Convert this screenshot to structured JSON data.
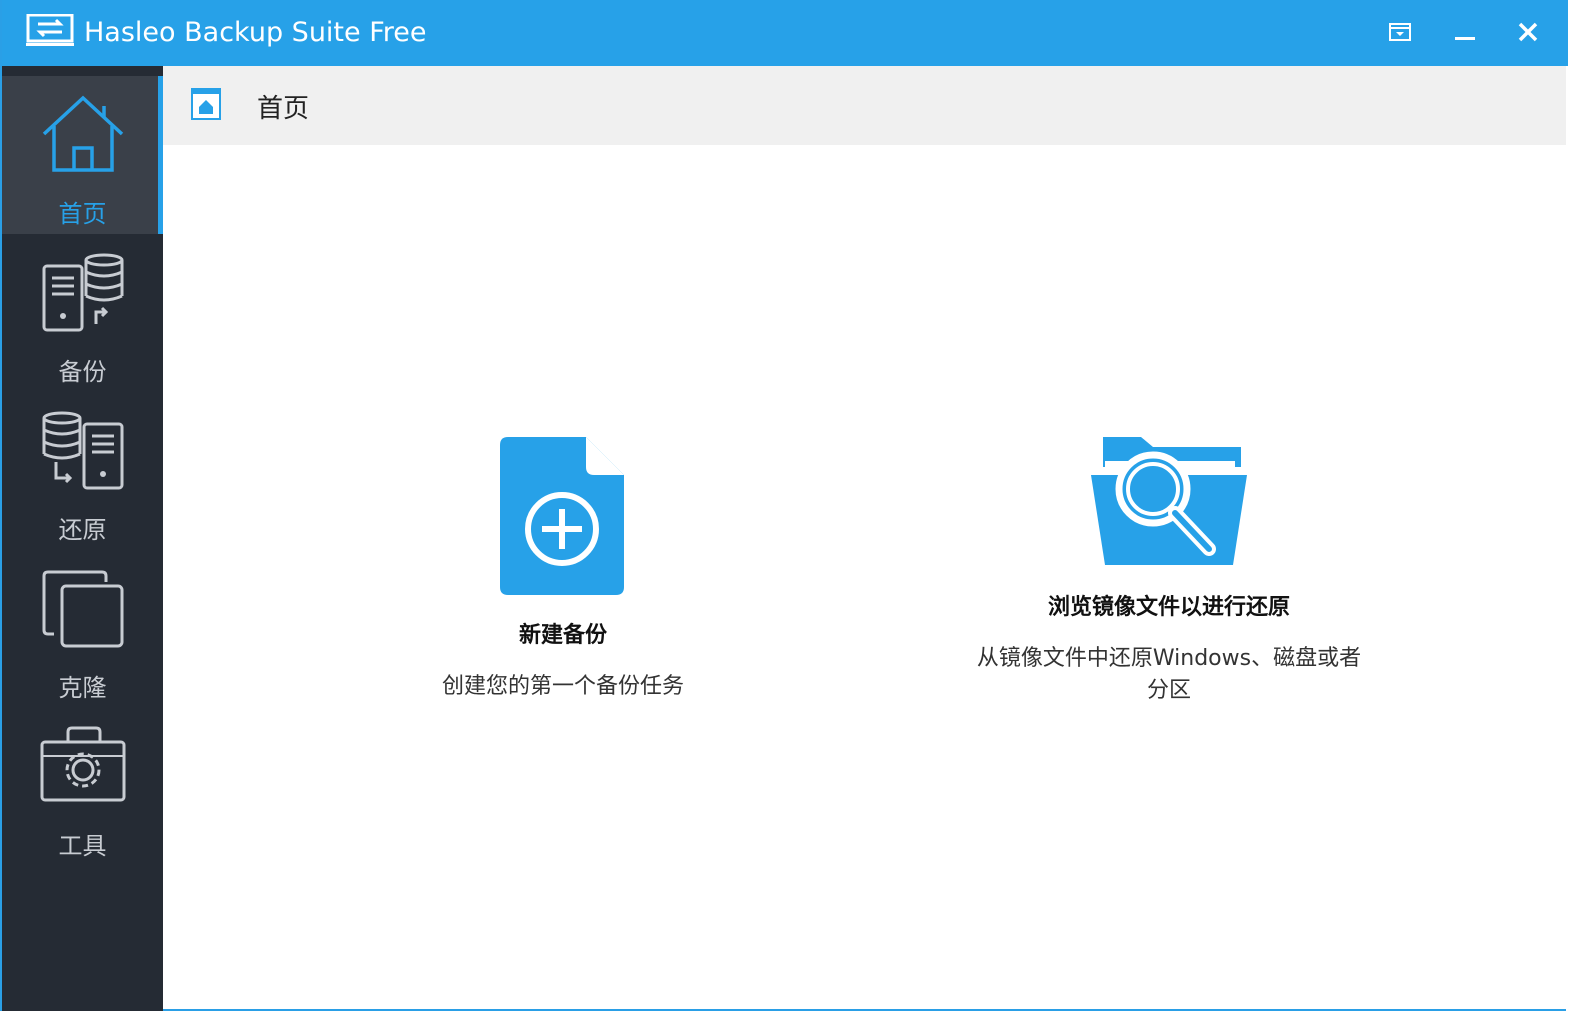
{
  "window": {
    "title": "Hasleo Backup Suite Free"
  },
  "titlebar": {
    "menu_icon": "dropdown-menu-icon",
    "minimize_icon": "minimize-icon",
    "close_icon": "close-icon"
  },
  "sidebar": {
    "items": [
      {
        "label": "首页",
        "icon": "home-icon",
        "active": true
      },
      {
        "label": "备份",
        "icon": "backup-icon",
        "active": false
      },
      {
        "label": "还原",
        "icon": "restore-icon",
        "active": false
      },
      {
        "label": "克隆",
        "icon": "clone-icon",
        "active": false
      },
      {
        "label": "工具",
        "icon": "tools-icon",
        "active": false
      }
    ]
  },
  "header": {
    "title": "首页"
  },
  "main": {
    "cards": [
      {
        "title": "新建备份",
        "desc": "创建您的第一个备份任务",
        "icon": "new-backup-file-icon"
      },
      {
        "title": "浏览镜像文件以进行还原",
        "desc": "从镜像文件中还原Windows、磁盘或者分区",
        "icon": "browse-image-folder-icon"
      }
    ]
  },
  "colors": {
    "accent": "#27a1e8",
    "sidebar_bg": "#252b34",
    "sidebar_active_bg": "#3a4049",
    "header_bg": "#f0f0f0"
  }
}
